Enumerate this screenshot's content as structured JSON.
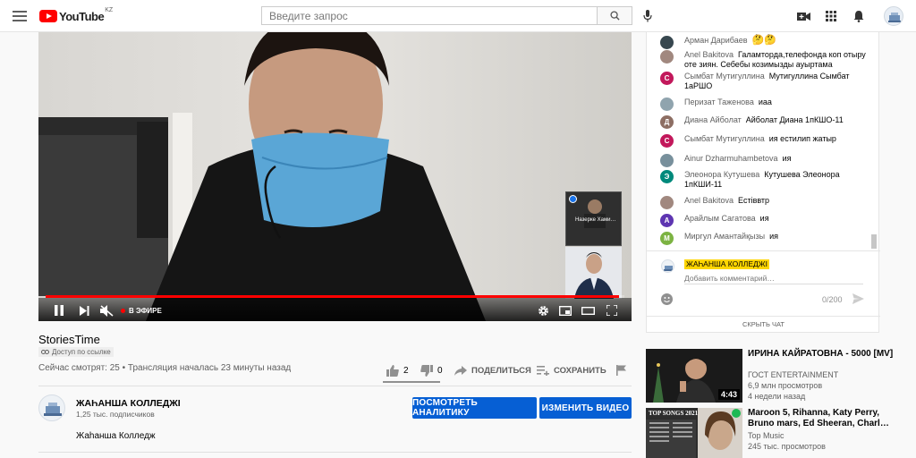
{
  "header": {
    "logo_text": "YouTube",
    "country": "KZ",
    "search_placeholder": "Введите запрос"
  },
  "player": {
    "live_label": "В ЭФИРЕ",
    "pip_top_label": "Назерке Хами…",
    "progress": 0.99
  },
  "video": {
    "title": "StoriesTime",
    "privacy": "Доступ по ссылке",
    "stats": "Сейчас смотрят: 25 • Трансляция началась 23 минуты назад",
    "likes": "2",
    "dislikes": "0",
    "share_label": "ПОДЕЛИТЬСЯ",
    "save_label": "СОХРАНИТЬ"
  },
  "channel": {
    "name": "ЖАҺАНША КОЛЛЕДЖІ",
    "subscribers": "1,25 тыс. подписчиков",
    "analytics_label": "ПОСМОТРЕТЬ АНАЛИТИКУ",
    "edit_label": "ИЗМЕНИТЬ ВИДЕО",
    "description": "Жаһанша Колледж"
  },
  "chat": {
    "messages": [
      {
        "author": "Арман Дарибаев",
        "text": "",
        "emoji": "🤔🤔",
        "initial": "",
        "color": "#37474f"
      },
      {
        "author": "Anel Bakitova",
        "text": "Галамторда,телефонда коп отыру оте зиян. Себебы козимызды ауыртама",
        "initial": "",
        "color": "#a1887f"
      },
      {
        "author": "Сымбат Мутигуллина",
        "text": "Мутигуллина Сымбат 1аРШО",
        "initial": "С",
        "color": "#c2185b"
      },
      {
        "author": "Перизат Таженова",
        "text": "иаа",
        "initial": "",
        "color": "#90a4ae"
      },
      {
        "author": "Диана Айболат",
        "text": "Айболат Диана 1пКШО-11",
        "initial": "Д",
        "color": "#8d6e63"
      },
      {
        "author": "Сымбат Мутигуллина",
        "text": "ия естилип жатыр",
        "initial": "С",
        "color": "#c2185b"
      },
      {
        "author": "Ainur Dzharmuhambetova",
        "text": "ия",
        "initial": "",
        "color": "#78909c"
      },
      {
        "author": "Элеонора Кутушева",
        "text": "Кутушева Элеонора 1пКШИ-11",
        "initial": "Э",
        "color": "#00897b"
      },
      {
        "author": "Anel Bakitova",
        "text": "Естіввтр",
        "initial": "",
        "color": "#a1887f"
      },
      {
        "author": "Арайлым Сагатова",
        "text": "ия",
        "initial": "А",
        "color": "#5e35b1"
      },
      {
        "author": "Миргул Амантайқызы",
        "text": "ия",
        "initial": "М",
        "color": "#7cb342"
      }
    ],
    "composer_channel": "ЖАҺАНША КОЛЛЕДЖІ",
    "comment_placeholder": "Добавить комментарий…",
    "counter": "0/200",
    "hide_label": "СКРЫТЬ ЧАТ"
  },
  "recommendations": [
    {
      "title": "ИРИНА КАЙРАТОВНА - 5000 [MV]",
      "channel": "ГОСТ ENTERTAINMENT",
      "views": "6,9 млн просмотров",
      "age": "4 недели назад",
      "duration": "4:43"
    },
    {
      "title": "Maroon 5, Rihanna, Katy Perry, Bruno mars, Ed Sheeran, Charl…",
      "channel": "Top Music",
      "views": "245 тыс. просмотров",
      "age": "",
      "duration": "",
      "thumb_text": "TOP SONGS 2021"
    }
  ]
}
